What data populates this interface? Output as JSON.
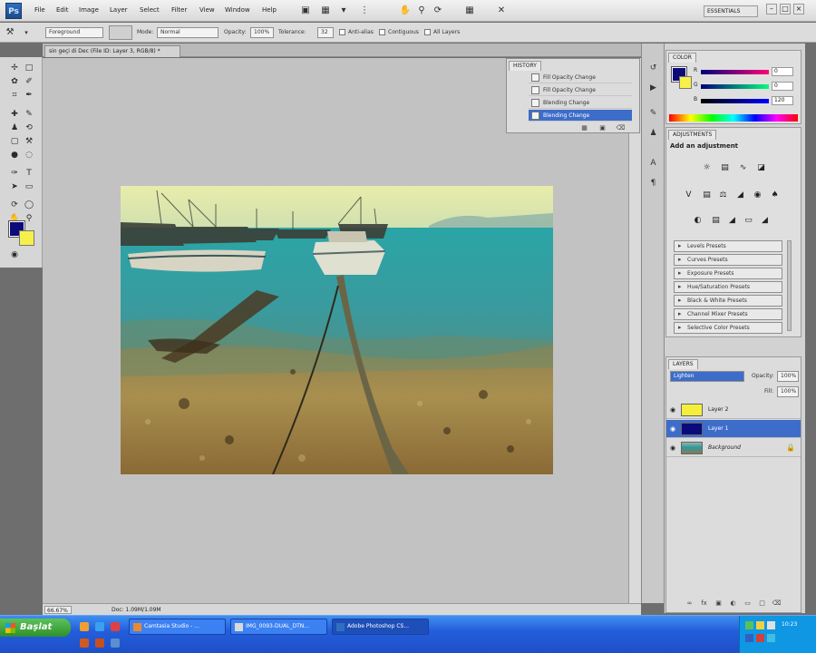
{
  "app": {
    "logo": "Ps"
  },
  "menu": {
    "items": [
      "File",
      "Edit",
      "Image",
      "Layer",
      "Select",
      "Filter",
      "View",
      "Window",
      "Help"
    ],
    "workspace": "ESSENTIALS"
  },
  "options": {
    "fill": "Foreground",
    "mode_label": "Mode:",
    "mode": "Normal",
    "opacity_label": "Opacity:",
    "opacity": "100%",
    "tolerance_label": "Tolerance:",
    "tolerance": "32",
    "antialias": "Anti-alias",
    "contiguous": "Contiguous",
    "all_layers": "All Layers"
  },
  "document": {
    "tab": "sin geçi di Dec (File ID: Layer 3, RGB/8) *"
  },
  "history": {
    "tab": "HISTORY",
    "rows": [
      "Fill Opacity Change",
      "Fill Opacity Change",
      "Blending Change",
      "Blending Change"
    ],
    "selected_index": 3
  },
  "color_panel": {
    "tab": "COLOR",
    "r": "0",
    "g": "0",
    "b": "120",
    "fg": "#0b0b7a",
    "bg": "#f7f04a"
  },
  "adjustments": {
    "tab": "ADJUSTMENTS",
    "title": "Add an adjustment",
    "presets": [
      "Levels Presets",
      "Curves Presets",
      "Exposure Presets",
      "Hue/Saturation Presets",
      "Black & White Presets",
      "Channel Mixer Presets",
      "Selective Color Presets"
    ]
  },
  "layers": {
    "tab": "LAYERS",
    "blend": "Lighten",
    "opacity_label": "Opacity:",
    "opacity": "100%",
    "fill_label": "Fill:",
    "fill": "100%",
    "rows": [
      {
        "name": "Layer 2",
        "thumb": "#f5ef3c"
      },
      {
        "name": "Layer 1",
        "thumb": "#0a0a7a"
      },
      {
        "name": "Background",
        "thumb": "#8a7b52"
      }
    ],
    "selected_index": 1
  },
  "status": {
    "zoom": "66.67%",
    "doc": "Doc: 1.09M/1.09M"
  },
  "taskbar": {
    "start": "Başlat",
    "tasks": [
      "Camtasia Studio - ...",
      "IMG_0093-DUAL_DTN...",
      "Adobe Photoshop CS..."
    ],
    "clock": "10:23"
  }
}
